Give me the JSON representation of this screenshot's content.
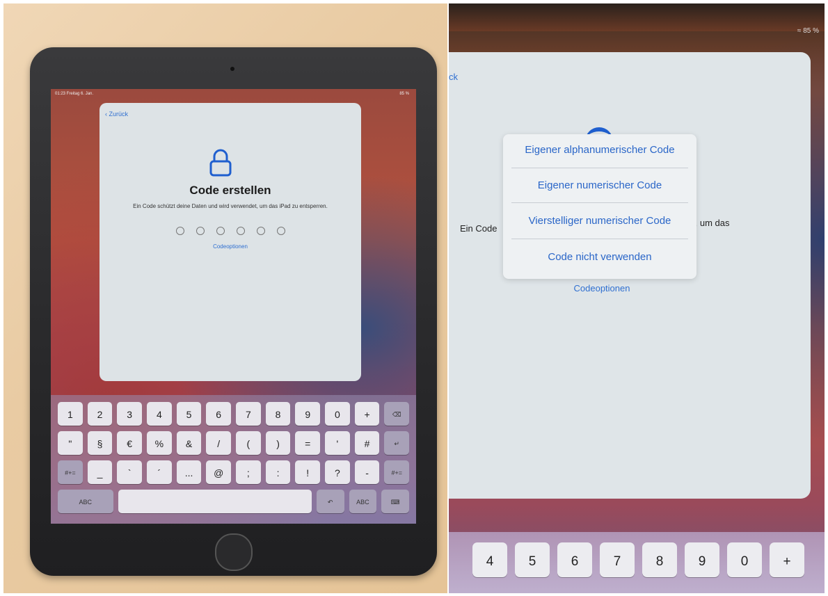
{
  "left": {
    "status_time": "01:23  Freitag 6. Jan.",
    "status_battery": "85 %",
    "back_label": "Zurück",
    "title": "Code erstellen",
    "description": "Ein Code schützt deine Daten und wird verwendet, um das iPad zu entsperren.",
    "code_options": "Codeoptionen",
    "keyboard": {
      "row1": [
        "1",
        "2",
        "3",
        "4",
        "5",
        "6",
        "7",
        "8",
        "9",
        "0",
        "+"
      ],
      "row2": [
        "\"",
        "§",
        "€",
        "%",
        "&",
        "/",
        "(",
        ")",
        "=",
        "'",
        "#"
      ],
      "row3": [
        "#+=",
        "_",
        "`",
        "´",
        "...",
        "@",
        ";",
        ":",
        "!",
        "?",
        "-",
        "#+="
      ],
      "abc_left": "ABC",
      "abc_right": "ABC"
    }
  },
  "right": {
    "status_battery": "85 %",
    "back_fragment": "ck",
    "description_left": "Ein Code",
    "description_right": "t, um das",
    "menu": [
      "Eigener alphanumerischer Code",
      "Eigener numerischer Code",
      "Vierstelliger numerischer Code",
      "Code nicht verwenden"
    ],
    "code_options": "Codeoptionen",
    "keys": [
      "4",
      "5",
      "6",
      "7",
      "8",
      "9",
      "0",
      "+"
    ]
  }
}
